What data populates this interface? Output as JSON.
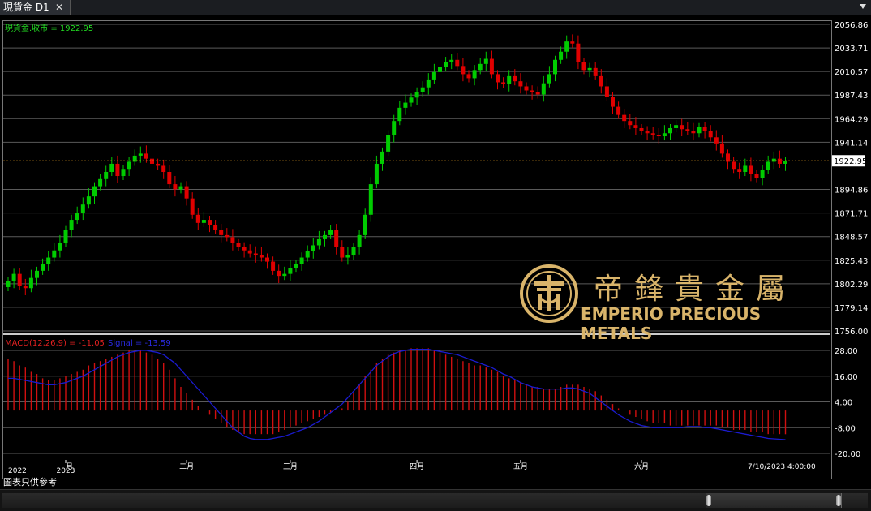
{
  "window": {
    "tab_title": "現貨金 D1",
    "close_glyph": "✕"
  },
  "price_panel": {
    "legend": "現貨金.收市 = 1922.95",
    "current_price_label": "1922.95",
    "y_ticks": [
      "2056.86",
      "2033.71",
      "2010.57",
      "1987.43",
      "1964.29",
      "1941.14",
      "1894.86",
      "1871.71",
      "1848.57",
      "1825.43",
      "1802.29",
      "1779.14",
      "1756.00"
    ],
    "y_range": [
      1756.0,
      2056.86
    ],
    "current_price": 1922.95,
    "colors": {
      "up": "#00cc00",
      "down": "#e00000",
      "grid": "#5a5a5a",
      "price_line": "#e8a020",
      "axis_text": "#ffffff"
    }
  },
  "macd_panel": {
    "legend_macd": "MACD(12,26,9) = -11.05",
    "legend_signal": "Signal = -13.59",
    "y_ticks": [
      "28.00",
      "16.00",
      "4.00",
      "-8.00",
      "-20.00"
    ],
    "y_range": [
      -20.0,
      28.0
    ],
    "colors": {
      "histogram": "#d01010",
      "signal": "#1b1bd0"
    }
  },
  "x_axis": {
    "labels": [
      {
        "text": "2022",
        "idx": 0
      },
      {
        "text": "一月",
        "idx": 10
      },
      {
        "text": "2023",
        "idx": 10
      },
      {
        "text": "二月",
        "idx": 31
      },
      {
        "text": "三月",
        "idx": 49
      },
      {
        "text": "四月",
        "idx": 71
      },
      {
        "text": "五月",
        "idx": 89
      },
      {
        "text": "六月",
        "idx": 110
      },
      {
        "text": "7/10/2023 4:00:00",
        "idx": 133
      }
    ]
  },
  "footer": {
    "disclaimer": "圖表只供參考"
  },
  "logo": {
    "chinese": "帝鋒貴金屬",
    "english": "EMPERIO PRECIOUS METALS"
  },
  "chart_data": {
    "type": "candlestick",
    "title": "現貨金 D1",
    "ylim": [
      1756.0,
      2056.86
    ],
    "close": [
      1805,
      1812,
      1800,
      1798,
      1808,
      1815,
      1822,
      1828,
      1835,
      1842,
      1855,
      1865,
      1872,
      1880,
      1888,
      1898,
      1905,
      1912,
      1920,
      1908,
      1915,
      1922,
      1928,
      1930,
      1925,
      1920,
      1918,
      1912,
      1900,
      1895,
      1898,
      1886,
      1870,
      1862,
      1865,
      1860,
      1855,
      1850,
      1848,
      1842,
      1838,
      1835,
      1832,
      1830,
      1828,
      1824,
      1815,
      1810,
      1812,
      1818,
      1822,
      1828,
      1834,
      1840,
      1846,
      1850,
      1855,
      1838,
      1828,
      1830,
      1838,
      1850,
      1870,
      1900,
      1920,
      1932,
      1948,
      1962,
      1975,
      1980,
      1985,
      1990,
      1995,
      2002,
      2010,
      2015,
      2020,
      2022,
      2016,
      2008,
      2004,
      2012,
      2018,
      2023,
      2008,
      2000,
      1998,
      2006,
      2001,
      1996,
      1992,
      1990,
      1988,
      1999,
      2008,
      2022,
      2030,
      2040,
      2038,
      2020,
      2012,
      2014,
      2006,
      1996,
      1986,
      1976,
      1968,
      1962,
      1958,
      1955,
      1952,
      1950,
      1948,
      1947,
      1950,
      1955,
      1958,
      1954,
      1952,
      1950,
      1956,
      1952,
      1946,
      1940,
      1930,
      1922,
      1915,
      1912,
      1918,
      1910,
      1906,
      1914,
      1922,
      1925,
      1920,
      1922.95
    ],
    "macd_hist": [
      24,
      23,
      21,
      20,
      18,
      17,
      15,
      14,
      14,
      15,
      16,
      17,
      18,
      19,
      21,
      22,
      23,
      24,
      25,
      26,
      27,
      28,
      28,
      28,
      27,
      26,
      24,
      22,
      19,
      15,
      11,
      8,
      5,
      2,
      0,
      -2,
      -4,
      -6,
      -8,
      -9,
      -10,
      -11,
      -11,
      -11,
      -11,
      -11,
      -11,
      -10,
      -9,
      -8,
      -7,
      -6,
      -5,
      -4,
      -3,
      -2,
      -1,
      0,
      1,
      4,
      8,
      12,
      16,
      19,
      22,
      24,
      26,
      27,
      28,
      28,
      29,
      29,
      29,
      29,
      28,
      27,
      26,
      25,
      24,
      23,
      22,
      21,
      21,
      20,
      19,
      18,
      16,
      15,
      14,
      13,
      12,
      11,
      11,
      10,
      10,
      10,
      11,
      12,
      12,
      12,
      11,
      10,
      9,
      7,
      5,
      3,
      1,
      0,
      -2,
      -3,
      -4,
      -5,
      -6,
      -6,
      -6,
      -7,
      -7,
      -7,
      -7,
      -7,
      -7,
      -7,
      -7,
      -7,
      -8,
      -8,
      -9,
      -9,
      -9,
      -10,
      -10,
      -10,
      -11,
      -11,
      -11,
      -11.05
    ],
    "macd_signal": [
      15,
      15,
      14.5,
      14,
      13.5,
      13,
      12.5,
      12,
      12,
      12.5,
      13,
      14,
      15,
      16,
      17.5,
      19,
      20.5,
      22,
      23.5,
      25,
      26,
      27,
      27.5,
      28,
      28,
      27.5,
      27,
      26,
      24,
      22,
      19,
      16,
      13,
      10,
      7,
      4,
      1,
      -2,
      -5,
      -8,
      -10,
      -12,
      -13,
      -13.5,
      -13.5,
      -13.5,
      -13,
      -12.5,
      -12,
      -11,
      -10,
      -9,
      -8,
      -6.5,
      -5,
      -3,
      -1,
      1,
      3,
      6,
      9,
      12,
      15,
      18,
      21,
      23,
      25,
      26.5,
      27.5,
      28,
      28.5,
      28.5,
      28.5,
      28.5,
      28,
      27.5,
      27,
      26.5,
      26,
      25,
      24,
      23,
      22,
      21,
      20,
      18.5,
      17,
      16,
      14.5,
      13,
      12,
      11,
      10.5,
      10,
      10,
      10,
      10,
      10.5,
      10.5,
      10,
      9,
      8,
      6,
      4,
      2,
      0,
      -2,
      -3.5,
      -5,
      -6,
      -7,
      -7.5,
      -8,
      -8,
      -8,
      -8,
      -8,
      -8,
      -7.5,
      -7.5,
      -7.5,
      -8,
      -8,
      -8.5,
      -9,
      -9.5,
      -10,
      -10.5,
      -11,
      -11.5,
      -12,
      -12.5,
      -13,
      -13.2,
      -13.4,
      -13.59
    ]
  }
}
